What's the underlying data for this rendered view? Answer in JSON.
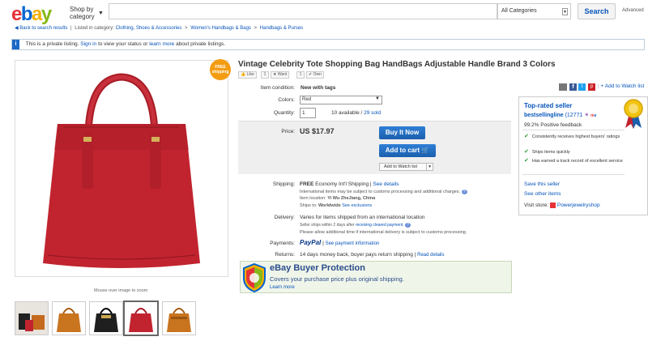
{
  "header": {
    "logo_letters": [
      "e",
      "b",
      "a",
      "y"
    ],
    "shop_by": "Shop by",
    "category": "category",
    "search_placeholder": "",
    "category_select": "All Categories",
    "search_button": "Search",
    "advanced": "Advanced"
  },
  "breadcrumb": {
    "back": "Back to search results",
    "listed_in": "Listed in category:",
    "items": [
      "Clothing, Shoes & Accessories",
      "Women's Handbags & Bags",
      "Handbags & Purses"
    ]
  },
  "notice": {
    "icon": "i",
    "text_a": "This is a private listing.",
    "sign_in": "Sign in",
    "text_b": "to view your status or",
    "learn_more": "learn more",
    "text_c": "about private listings."
  },
  "gallery": {
    "free_badge_line1": "FREE",
    "free_badge_line2": "shipping",
    "zoom_hint": "Mouse over image to zoom",
    "thumbnails": [
      "thumb-1",
      "thumb-2",
      "thumb-3",
      "thumb-4",
      "thumb-5"
    ],
    "selected_thumbnail": 3
  },
  "listing": {
    "title": "Vintage Celebrity Tote Shopping Bag HandBags Adjustable Handle Brand 3 Colors",
    "like": "Like",
    "like_count": "1",
    "want": "Want",
    "want_count": "1",
    "own": "Own",
    "condition_label": "Item condition:",
    "condition_value": "New with tags",
    "colors_label": "Colors:",
    "colors_value": "Red",
    "quantity_label": "Quantity:",
    "quantity_value": "1",
    "available": "10 available /",
    "sold": "29 sold",
    "price_label": "Price:",
    "price_value": "US $17.97",
    "buy_now": "Buy It Now",
    "add_to_cart": "Add to cart",
    "add_to_watch": "Add to Watch list",
    "add_to_watch_dropdown": "▾"
  },
  "shipping": {
    "label": "Shipping:",
    "free": "FREE",
    "method": "Economy Int'l Shipping |",
    "see_details": "See details",
    "intl_note": "International items may be subject to customs processing and additional charges.",
    "location_label": "Item location:",
    "location_value": "Yi Wu ZheJiang, China",
    "ships_to_label": "Ships to:",
    "ships_to_value": "Worldwide",
    "see_exclusions": "See exclusions"
  },
  "delivery": {
    "label": "Delivery:",
    "value": "Varies for items shipped from an international location",
    "note1_a": "Seller ships within 2 days after",
    "note1_b": "receiving cleared payment.",
    "note2": "Please allow additional time if international delivery is subject to customs processing."
  },
  "payments": {
    "label": "Payments:",
    "paypal": "PayPal",
    "see_info": "See payment information"
  },
  "returns": {
    "label": "Returns:",
    "value": "14 days money back, buyer pays return shipping |",
    "read_details": "Read details"
  },
  "protection": {
    "title": "eBay Buyer Protection",
    "subtitle": "Covers your purchase price plus original shipping.",
    "learn_more": "Learn more"
  },
  "share": {
    "add_to_watch": "Add to Watch list"
  },
  "seller": {
    "top_rated": "Top-rated seller",
    "name": "bestsellingline",
    "feedback_count": "(12771",
    "positive": "99.2% Positive feedback",
    "bullets": [
      "Consistently receives highest buyers' ratings",
      "Ships items quickly",
      "Has earned a track record of excellent service"
    ],
    "save_seller": "Save this seller",
    "see_other": "See other items",
    "visit_store_label": "Visit store:",
    "store_name": "Powerjewelryshop"
  },
  "colors": {
    "bag_red": "#c1242f",
    "link_blue": "#0654ba",
    "badge_orange": "#f39c12",
    "paypal_blue": "#003087"
  }
}
